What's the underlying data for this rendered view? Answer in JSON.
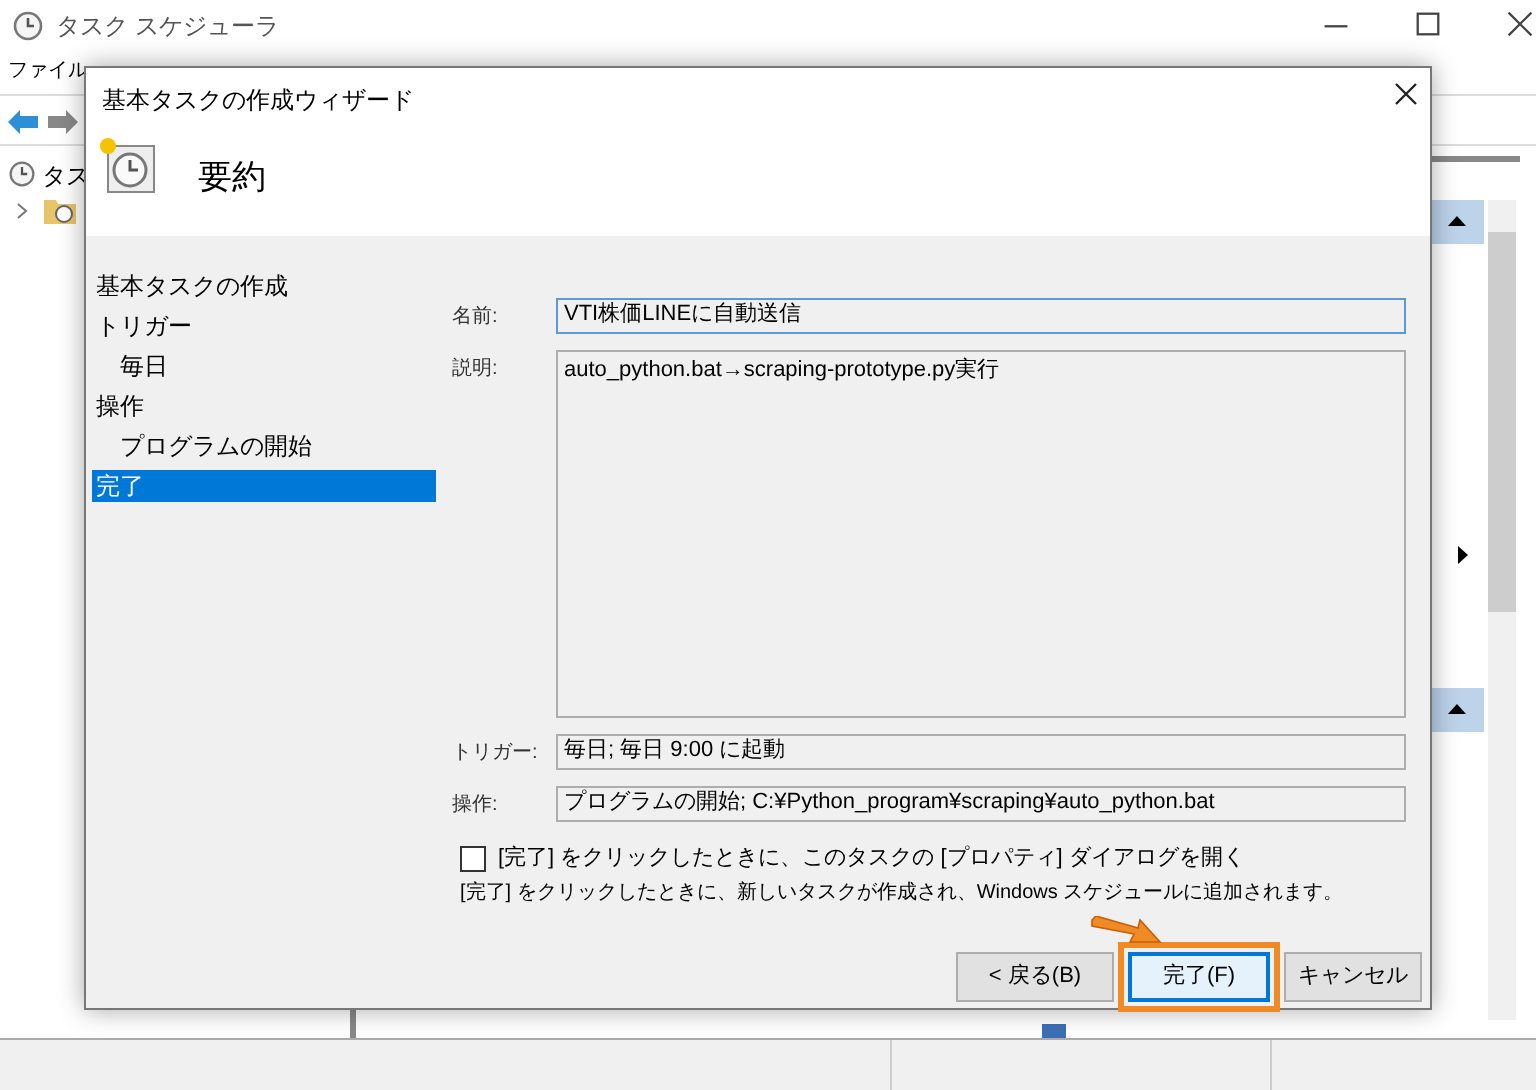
{
  "main_window": {
    "title": "タスク スケジューラ",
    "menu": [
      "ファイル"
    ],
    "tree_root": "タス"
  },
  "dialog": {
    "title": "基本タスクの作成ウィザード",
    "heading": "要約",
    "steps": [
      {
        "label": "基本タスクの作成",
        "selected": false
      },
      {
        "label": "トリガー",
        "selected": false,
        "children": [
          {
            "label": "毎日",
            "selected": false
          }
        ]
      },
      {
        "label": "操作",
        "selected": false,
        "children": [
          {
            "label": "プログラムの開始",
            "selected": false
          }
        ]
      },
      {
        "label": "完了",
        "selected": true
      }
    ],
    "fields": [
      {
        "label": "名前:",
        "value": "VTI株価LINEに自動送信",
        "kind": "input"
      },
      {
        "label": "説明:",
        "value": "auto_python.bat→scraping-prototype.py実行",
        "kind": "textarea"
      },
      {
        "label": "トリガー:",
        "value": "毎日; 毎日  9:00 に起動",
        "kind": "readonly"
      },
      {
        "label": "操作:",
        "value": "プログラムの開始; C:¥Python_program¥scraping¥auto_python.bat",
        "kind": "readonly"
      }
    ],
    "open_properties": {
      "label": "[完了] をクリックしたときに、このタスクの [プロパティ] ダイアログを開く",
      "checked": false
    },
    "note": "[完了] をクリックしたときに、新しいタスクが作成され、Windows スケジュールに追加されます。",
    "buttons": [
      {
        "label": "< 戻る(B)",
        "kind": "default",
        "highlighted": false
      },
      {
        "label": "完了(F)",
        "kind": "focused",
        "highlighted": true
      },
      {
        "label": "キャンセル",
        "kind": "default",
        "highlighted": false
      }
    ]
  }
}
